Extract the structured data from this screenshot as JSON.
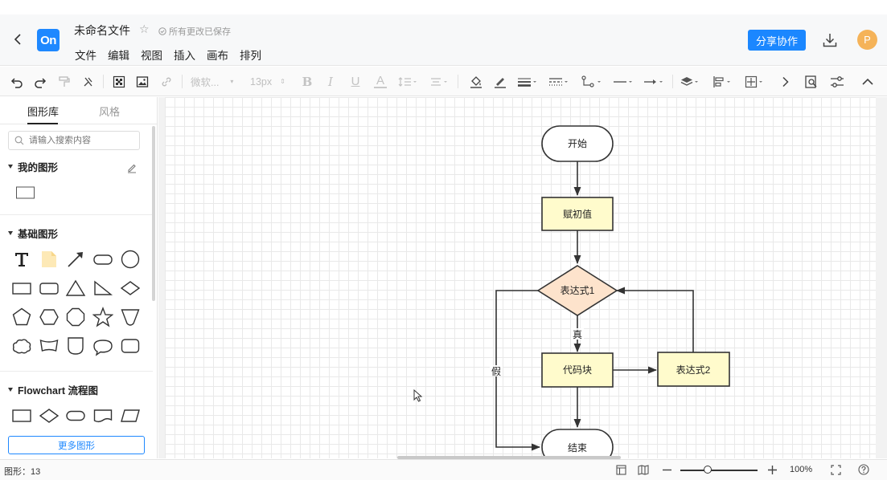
{
  "header": {
    "title": "未命名文件",
    "save_status": "所有更改已保存",
    "logo_text": "On",
    "menu": [
      "文件",
      "编辑",
      "视图",
      "插入",
      "画布",
      "排列"
    ],
    "share_label": "分享协作",
    "avatar_letter": "P"
  },
  "toolbar": {
    "font_family": "微软...",
    "font_size": "13px"
  },
  "sidebar": {
    "tabs": [
      "图形库",
      "风格"
    ],
    "search_placeholder": "请输入搜索内容",
    "sections": {
      "my_shapes": "我的图形",
      "basic_shapes": "基础图形",
      "flowchart": "Flowchart 流程图"
    },
    "more_label": "更多图形"
  },
  "flowchart": {
    "nodes": {
      "start": "开始",
      "init": "赋初值",
      "expr1": "表达式1",
      "code": "代码块",
      "expr2": "表达式2",
      "end": "结束"
    },
    "edge_labels": {
      "true": "真",
      "false": "假"
    },
    "colors": {
      "process_fill": "#fffbcc",
      "decision_fill": "#fde3cc",
      "terminal_fill": "#ffffff",
      "stroke": "#333333"
    }
  },
  "statusbar": {
    "shape_count": "图形：13",
    "zoom": "100%"
  }
}
